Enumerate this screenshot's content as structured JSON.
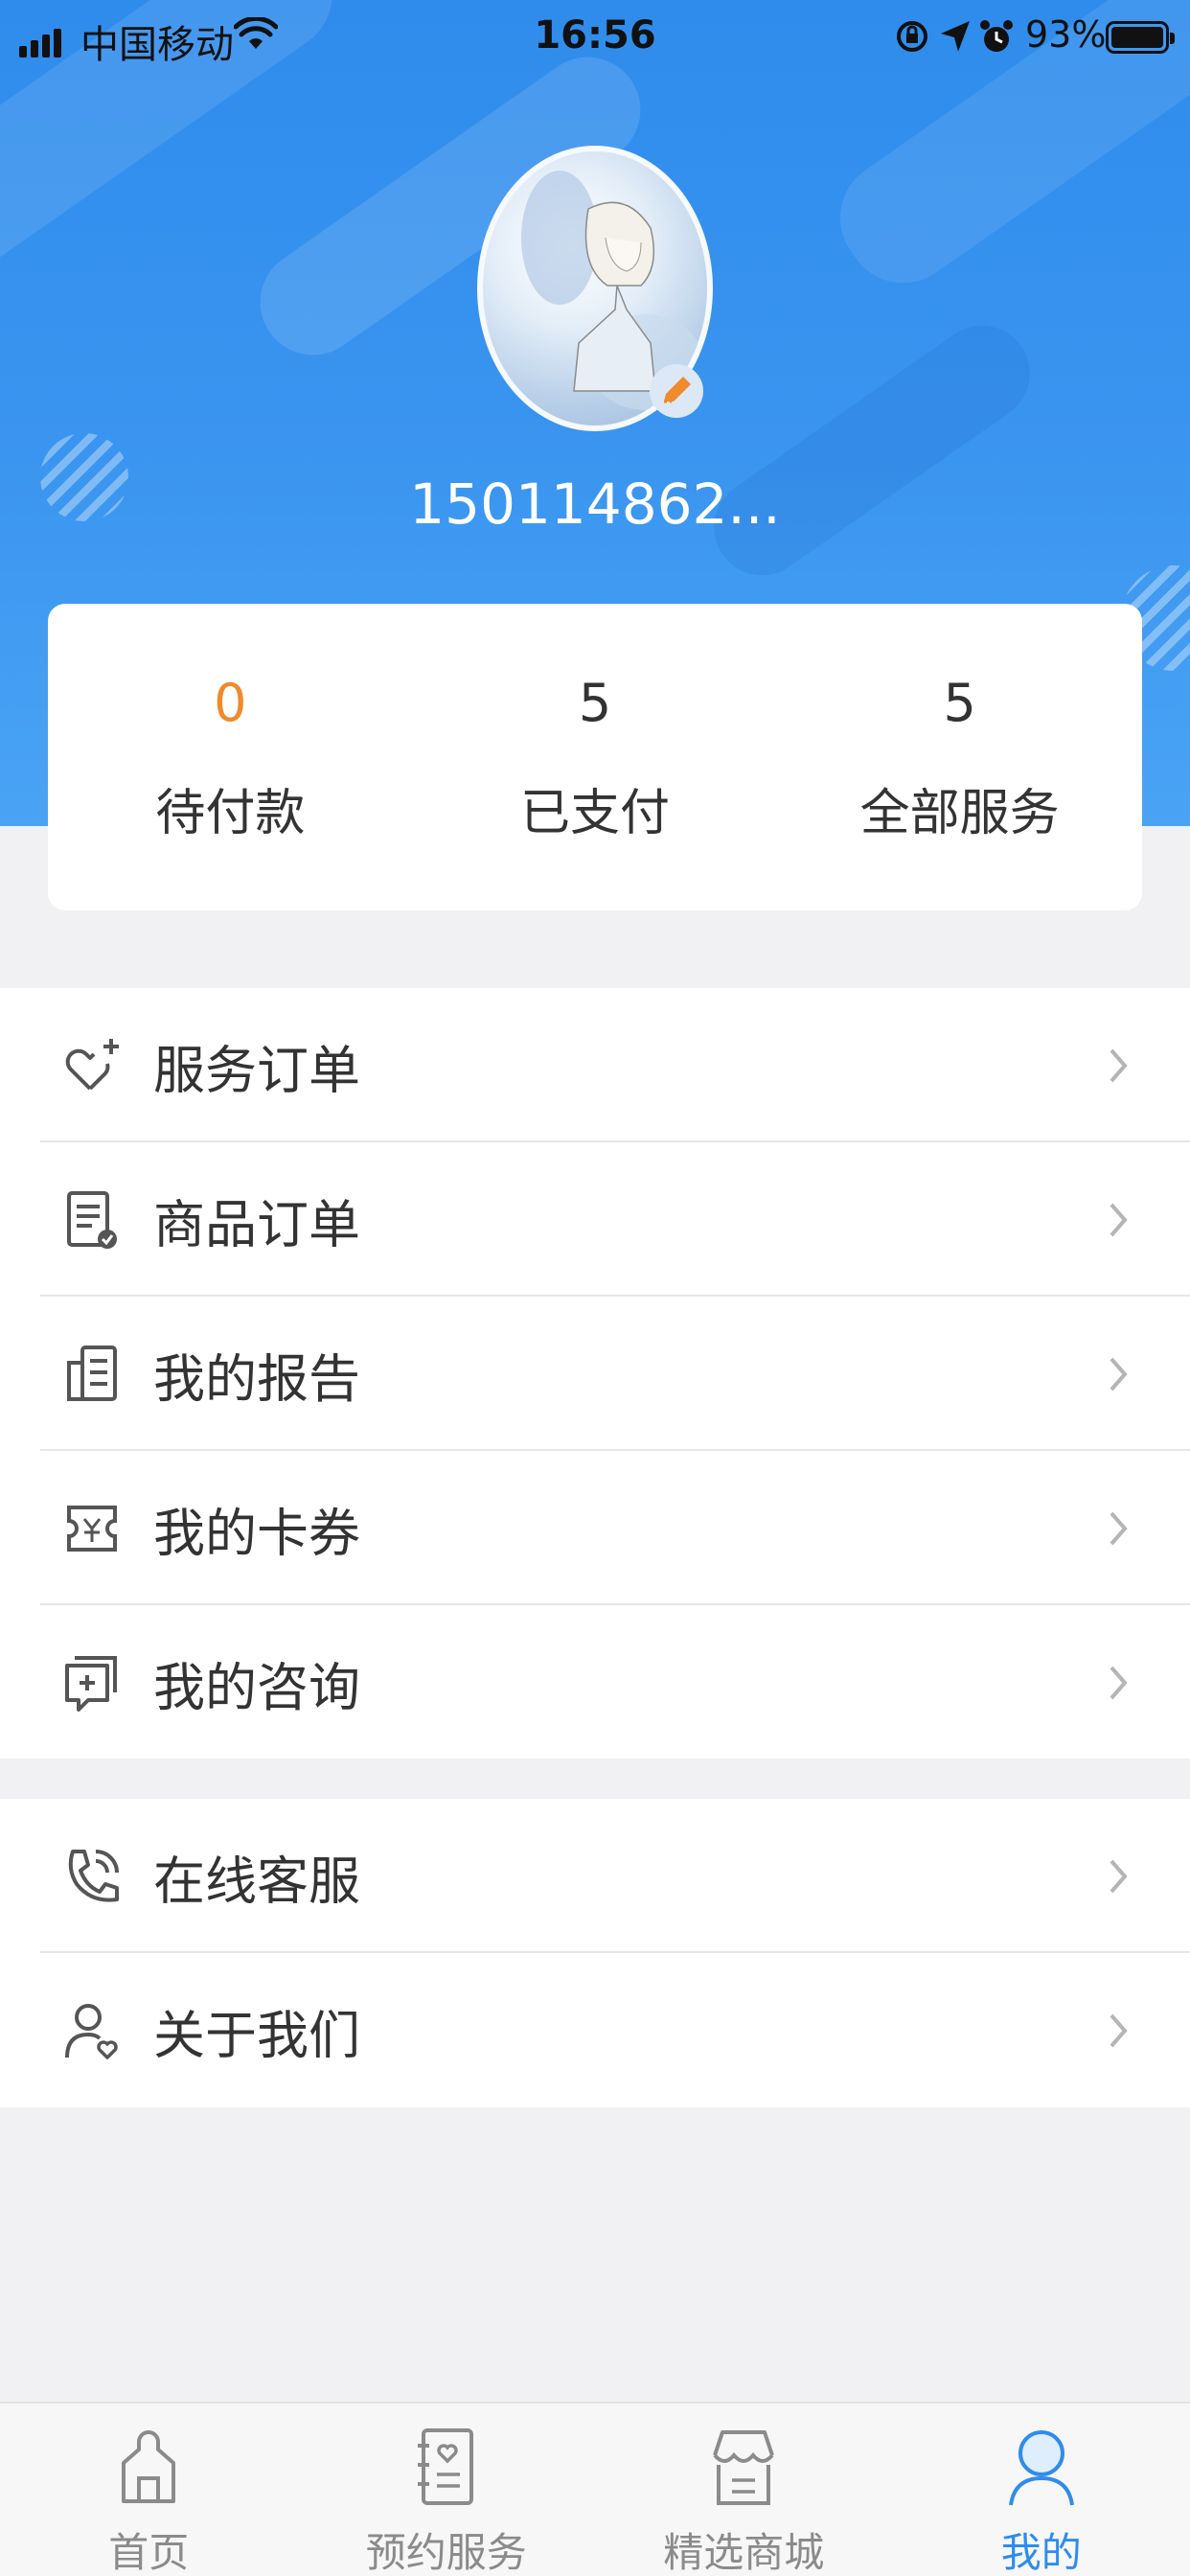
{
  "status_bar": {
    "carrier": "中国移动",
    "time": "16:56",
    "battery": "93%"
  },
  "profile": {
    "username": "150114862..."
  },
  "stats": [
    {
      "value": "0",
      "label": "待付款"
    },
    {
      "value": "5",
      "label": "已支付"
    },
    {
      "value": "5",
      "label": "全部服务"
    }
  ],
  "menu": {
    "group1": [
      {
        "label": "服务订单",
        "icon": "heart-plus-icon"
      },
      {
        "label": "商品订单",
        "icon": "order-check-icon"
      },
      {
        "label": "我的报告",
        "icon": "report-icon"
      },
      {
        "label": "我的卡券",
        "icon": "coupon-icon"
      },
      {
        "label": "我的咨询",
        "icon": "consult-icon"
      }
    ],
    "group2": [
      {
        "label": "在线客服",
        "icon": "phone-icon"
      },
      {
        "label": "关于我们",
        "icon": "user-heart-icon"
      }
    ]
  },
  "tabbar": {
    "items": [
      {
        "label": "首页",
        "icon": "home-icon"
      },
      {
        "label": "预约服务",
        "icon": "appointment-icon"
      },
      {
        "label": "精选商城",
        "icon": "store-icon"
      },
      {
        "label": "我的",
        "icon": "profile-icon",
        "active": true
      }
    ],
    "active_color": "#2f8cec"
  },
  "colors": {
    "header_blue": "#3a95f0",
    "pending_orange": "#f08a2b"
  }
}
